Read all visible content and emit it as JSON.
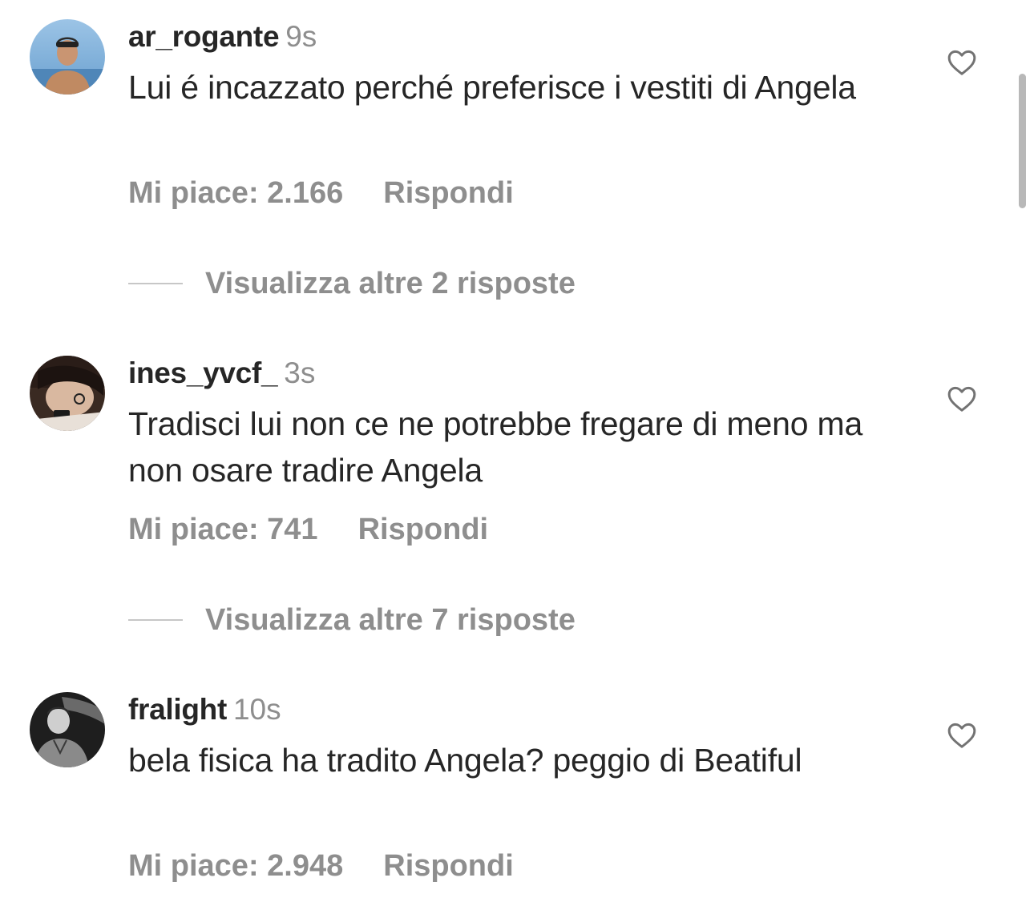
{
  "comments": [
    {
      "username": "ar_rogante",
      "time": "9s",
      "text": "Lui é incazzato perché preferisce i vestiti di Angela",
      "likes": "Mi piace: 2.166",
      "reply": "Rispondi",
      "view_replies": "Visualizza altre 2 risposte"
    },
    {
      "username": "ines_yvcf_",
      "time": "3s",
      "text": "Tradisci lui non ce ne potrebbe fregare di meno ma non osare tradire Angela",
      "likes": "Mi piace: 741",
      "reply": "Rispondi",
      "view_replies": "Visualizza altre 7 risposte"
    },
    {
      "username": "fralight",
      "time": "10s",
      "text": "bela fisica ha tradito Angela? peggio di Beatiful",
      "likes": "Mi piace: 2.948",
      "reply": "Rispondi"
    }
  ],
  "icons": {
    "like": "heart-outline-icon"
  },
  "colors": {
    "primary_text": "#262626",
    "secondary_text": "#8e8e8e",
    "divider": "#c7c7c7"
  }
}
